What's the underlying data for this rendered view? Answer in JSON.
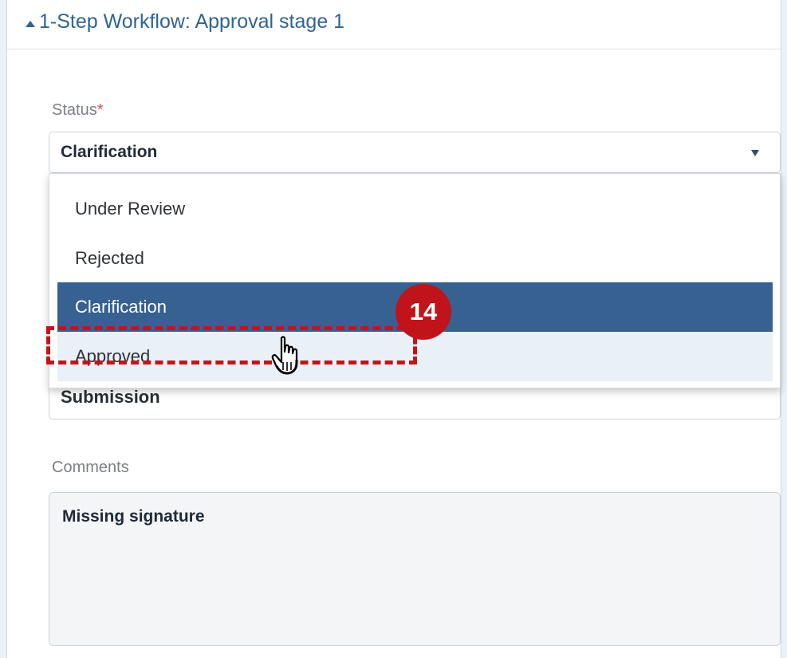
{
  "panel": {
    "title": "1-Step Workflow: Approval stage 1",
    "collapse_icon": "triangle-up-icon"
  },
  "status": {
    "label": "Status",
    "required_marker": "*",
    "value": "Clarification",
    "caret_icon": "caret-down-icon",
    "options": [
      {
        "label": "Under Review"
      },
      {
        "label": "Rejected"
      },
      {
        "label": "Clarification"
      },
      {
        "label": "Approved"
      }
    ],
    "selected_option": "Clarification",
    "hovered_option": "Approved"
  },
  "submission": {
    "value": "Submission"
  },
  "comments": {
    "label": "Comments",
    "value": "Missing signature"
  },
  "annotation": {
    "step_number": "14",
    "color": "#c0141a"
  },
  "colors": {
    "title": "#2e6496",
    "selected_bg": "#366191",
    "hover_bg": "#e9f0f7",
    "page_bg": "#eaf1f8"
  }
}
